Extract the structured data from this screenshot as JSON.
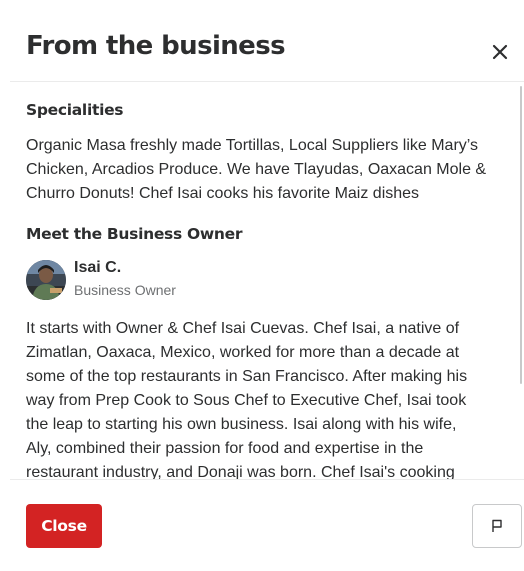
{
  "header": {
    "title": "From the business"
  },
  "icons": {
    "close": "close-icon",
    "flag": "flag-icon"
  },
  "specialities": {
    "heading": "Specialities",
    "lines": [
      "Organic Masa freshly made Tortillas, Local Suppliers like Mary’s",
      "Chicken, Arcadios Produce. We have Tlayudas, Oaxacan Mole &",
      "Churro Donuts! Chef Isai cooks his favorite Maiz dishes"
    ]
  },
  "owner_section": {
    "heading": "Meet the Business Owner",
    "name": "Isai C.",
    "role": "Business Owner"
  },
  "bio": {
    "lines": [
      "It starts with Owner & Chef Isai Cuevas. Chef Isai, a native of",
      "Zimatlan, Oaxaca, Mexico, worked for more than a decade at",
      "some of the top restaurants in San Francisco. After making his",
      "way from Prep Cook to Sous Chef to Executive Chef, Isai took",
      "the leap to starting his own business. Isai along with his wife,",
      "Aly, combined their passion for food and expertise in the",
      "restaurant industry, and Donaji was born. Chef Isai's cooking"
    ]
  },
  "footer": {
    "close_label": "Close"
  },
  "colors": {
    "primary": "#d32323",
    "text": "#2d2e2f",
    "muted": "#6e7072",
    "border": "#c8c9ca"
  }
}
